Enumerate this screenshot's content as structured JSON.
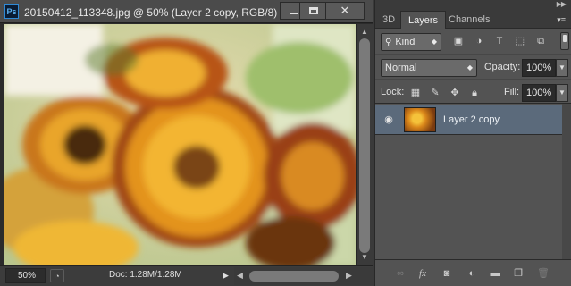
{
  "document": {
    "app_badge": "Ps",
    "title": "20150412_113348.jpg @ 50% (Layer 2 copy, RGB/8) *",
    "window_controls": {
      "minimize": "minimize",
      "maximize": "maximize",
      "close": "✕"
    },
    "zoom": "50%",
    "doc_size": "Doc: 1.28M/1.28M",
    "status_arrow": "▶"
  },
  "panel": {
    "tabs": [
      {
        "label": "3D"
      },
      {
        "label": "Layers",
        "active": true
      },
      {
        "label": "Channels"
      }
    ],
    "filter": {
      "kind_label": "Kind",
      "icons": [
        "image-filter-icon",
        "adjustment-filter-icon",
        "type-filter-icon",
        "shape-filter-icon",
        "smart-object-filter-icon"
      ]
    },
    "blend_mode": "Normal",
    "opacity_label": "Opacity:",
    "opacity_value": "100%",
    "lock_label": "Lock:",
    "fill_label": "Fill:",
    "fill_value": "100%",
    "layers": [
      {
        "name": "Layer 2 copy",
        "visible": true,
        "selected": true
      }
    ],
    "footer_icons": [
      "link-layers-icon",
      "fx-icon",
      "add-mask-icon",
      "adjustment-layer-icon",
      "new-group-icon",
      "new-layer-icon",
      "trash-icon"
    ]
  },
  "colors": {
    "selected_layer": "#5b6a7b",
    "panel_bg": "#535353",
    "titlebar_bg": "#4b4b4b"
  }
}
